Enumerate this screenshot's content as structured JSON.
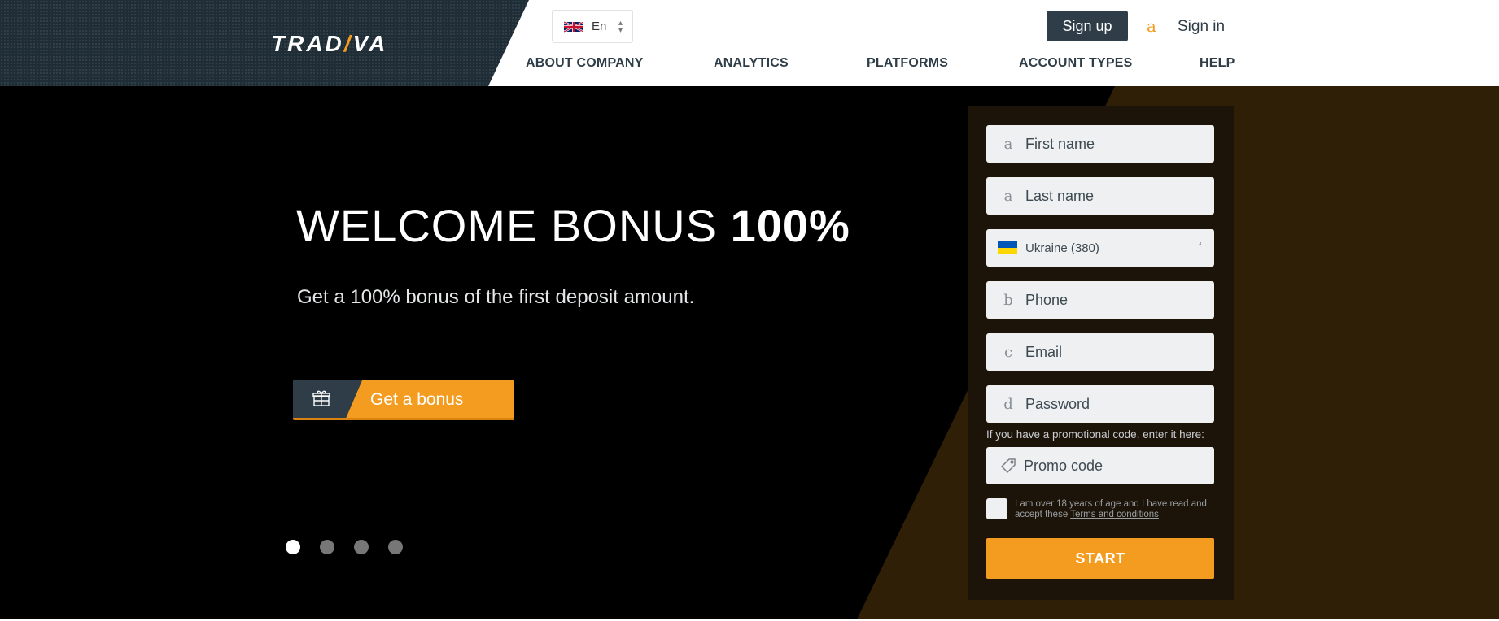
{
  "header": {
    "logo": {
      "prefix": "TRAD",
      "slash": "/",
      "suffix": "VA"
    },
    "language": {
      "label": "En",
      "caret": "⌃⌄"
    },
    "signup_label": "Sign up",
    "user_icon_glyph": "a",
    "signin_label": "Sign in",
    "nav": [
      {
        "label": "ABOUT COMPANY"
      },
      {
        "label": "ANALYTICS"
      },
      {
        "label": "PLATFORMS"
      },
      {
        "label": "ACCOUNT TYPES"
      },
      {
        "label": "HELP"
      }
    ]
  },
  "hero": {
    "title_light": "WELCOME BONUS ",
    "title_bold": "100%",
    "subtitle": "Get a 100% bonus of the first deposit amount.",
    "button_label": "Get a bonus",
    "slides": 4,
    "active_slide": 1
  },
  "form": {
    "fields": [
      {
        "icon_glyph": "a",
        "placeholder": "First name"
      },
      {
        "icon_glyph": "a",
        "placeholder": "Last name"
      },
      {
        "icon_glyph": "b",
        "placeholder": "Phone"
      },
      {
        "icon_glyph": "c",
        "placeholder": "Email"
      },
      {
        "icon_glyph": "d",
        "placeholder": "Password"
      }
    ],
    "country": {
      "value": "Ukraine (380)",
      "arrow_glyph": "f"
    },
    "promo_note": "If you have a promotional code, enter it here:",
    "promo_placeholder": "Promo code",
    "agree_text": "I am over 18 years of age and I have read and accept these ",
    "terms_link": "Terms and conditions",
    "start_label": "START"
  },
  "colors": {
    "accent": "#f39c1f",
    "dark": "#2e3d47",
    "hero_bg": "#000000",
    "hero_panel": "#2f1f07",
    "field_bg": "#eef0f2"
  }
}
